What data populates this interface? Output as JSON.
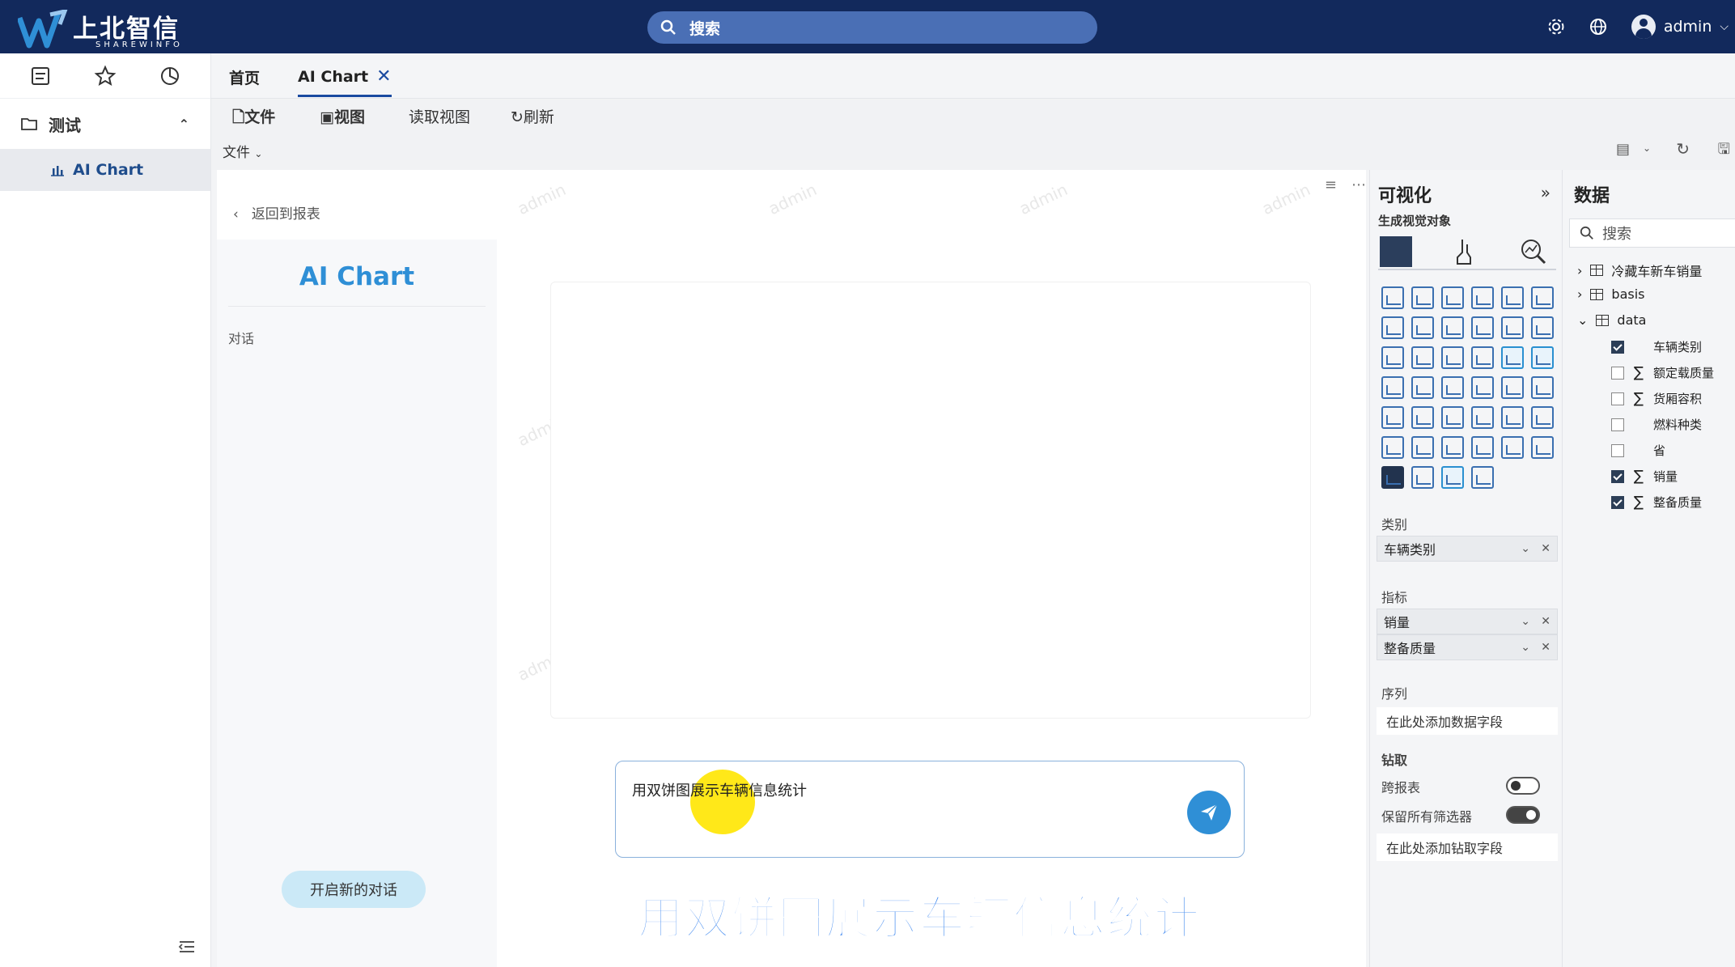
{
  "brand": {
    "name_cn": "上北智信",
    "name_en": "SHAREWINFO"
  },
  "header": {
    "search_label": "搜索",
    "user": "admin"
  },
  "nav": {
    "folder": "测试",
    "item": "AI Chart"
  },
  "tabs": [
    {
      "label": "首页"
    },
    {
      "label": "AI Chart"
    }
  ],
  "toolbar": {
    "file": "文件",
    "view": "视图",
    "read_view": "读取视图",
    "refresh": "刷新",
    "file_menu": "文件"
  },
  "canvas": {
    "back": "返回到报表",
    "chat_title": "AI Chart",
    "chat_label": "对话",
    "new_chat": "开启新的对话",
    "input_text": "用双饼图展示车辆信息统计",
    "caption": "用双饼图展示车辆信息统计",
    "watermark": "admin"
  },
  "viz": {
    "title": "可视化",
    "subtitle": "生成视觉对象",
    "category_label": "类别",
    "category_field": "车辆类别",
    "metric_label": "指标",
    "metric_fields": [
      "销量",
      "整备质量"
    ],
    "series_label": "序列",
    "series_placeholder": "在此处添加数据字段",
    "drill_label": "钻取",
    "cross_report": "跨报表",
    "keep_filters": "保留所有筛选器",
    "drill_placeholder": "在此处添加钻取字段"
  },
  "data": {
    "title": "数据",
    "search_placeholder": "搜索",
    "tables": [
      "冷藏车新车销量",
      "basis",
      "data"
    ],
    "fields": [
      {
        "name": "车辆类别",
        "checked": true,
        "sigma": false
      },
      {
        "name": "额定载质量",
        "checked": false,
        "sigma": true
      },
      {
        "name": "货厢容积",
        "checked": false,
        "sigma": true
      },
      {
        "name": "燃料种类",
        "checked": false,
        "sigma": false
      },
      {
        "name": "省",
        "checked": false,
        "sigma": false
      },
      {
        "name": "销量",
        "checked": true,
        "sigma": true
      },
      {
        "name": "整备质量",
        "checked": true,
        "sigma": true
      }
    ]
  },
  "colors": {
    "topbar": "#12295c",
    "accent": "#2f8fd6",
    "caption": "#4a8ff0"
  }
}
